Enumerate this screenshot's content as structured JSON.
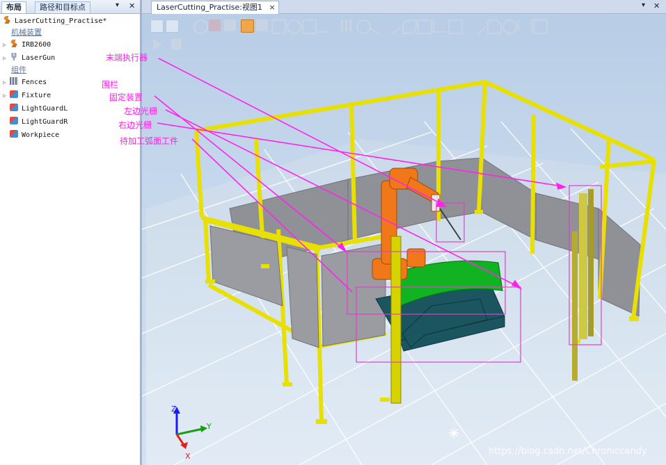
{
  "left_panel": {
    "tabs": [
      "布局",
      "路径和目标点"
    ],
    "tab_controls": {
      "pin": "▾",
      "close": "✕"
    },
    "station": "LaserCutting_Practise*",
    "group_mechanisms": "机械装置",
    "mechanisms": [
      {
        "name": "IRB2600",
        "icon": "robot-icon"
      },
      {
        "name": "LaserGun",
        "icon": "tool-icon"
      }
    ],
    "group_components": "组件",
    "components": [
      {
        "name": "Fences",
        "icon": "fence-icon"
      },
      {
        "name": "Fixture",
        "icon": "part-icon"
      },
      {
        "name": "LightGuardL",
        "icon": "part-icon"
      },
      {
        "name": "LightGuardR",
        "icon": "part-icon"
      },
      {
        "name": "Workpiece",
        "icon": "part-icon"
      }
    ]
  },
  "annotations": {
    "laser_gun": "末端执行器",
    "fences": "围栏",
    "fixture": "固定装置",
    "light_left": "左边光栅",
    "light_right": "右边光栅",
    "workpiece": "待加工弧面工件"
  },
  "view": {
    "tab_title": "LaserCutting_Practise:视图1",
    "tab_close": "×",
    "window_controls": {
      "menu": "▾",
      "close": "✕"
    }
  },
  "axes": {
    "z": "Z",
    "y": "Y",
    "x": "X"
  },
  "watermark": "https://blog.csdn.net/Chroniccandy",
  "colors": {
    "annotation": "#ff22ee",
    "fence": "#e8e000",
    "robot": "#f07818",
    "workpiece": "#10b020",
    "fixture": "#1a5560",
    "floor": "#d7e3f0"
  }
}
